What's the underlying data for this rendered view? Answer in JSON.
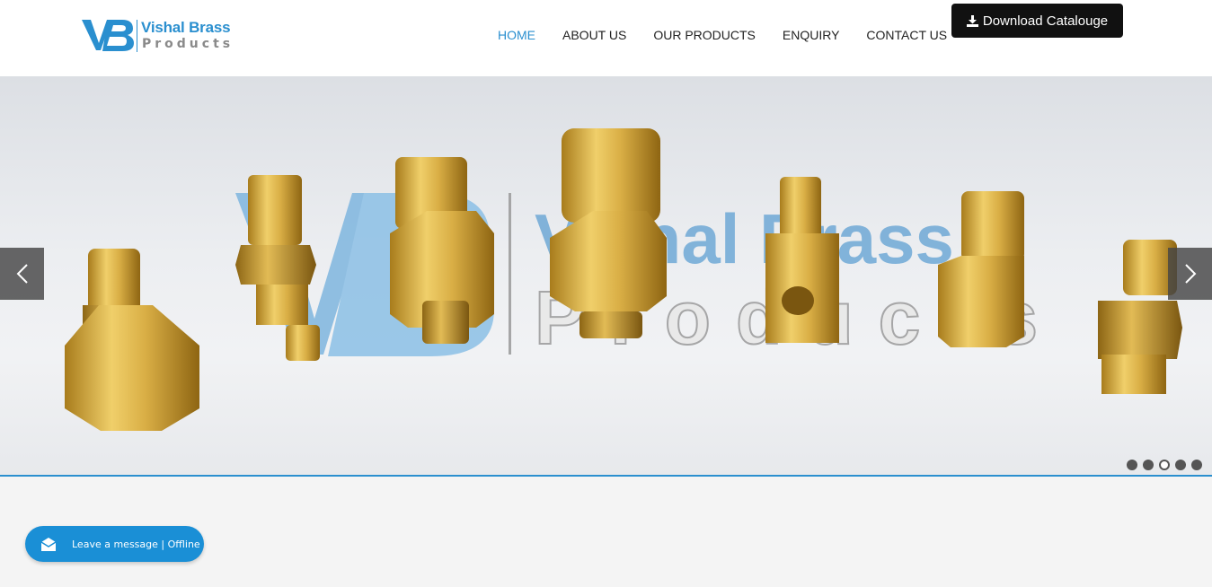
{
  "header": {
    "logo": {
      "initials": "VB",
      "name": "Vishal Brass",
      "sub": "Products"
    },
    "nav": [
      {
        "label": "HOME",
        "active": true
      },
      {
        "label": "ABOUT US",
        "active": false
      },
      {
        "label": "OUR PRODUCTS",
        "active": false
      },
      {
        "label": "ENQUIRY",
        "active": false
      },
      {
        "label": "CONTACT US",
        "active": false
      }
    ],
    "download_button": {
      "label": "Download Catalouge",
      "icon": "download-icon"
    }
  },
  "slider": {
    "watermark": {
      "initials": "VB",
      "name": "Vishal Brass",
      "sub": "Products"
    },
    "prev_icon": "chevron-left-icon",
    "next_icon": "chevron-right-icon",
    "dots_total": 5,
    "active_dot": 3
  },
  "chat": {
    "label": "Leave a message | Offline",
    "icon": "envelope-icon"
  },
  "colors": {
    "accent": "#2a8fcf",
    "brass": "#c9a036",
    "dark": "#111111"
  }
}
